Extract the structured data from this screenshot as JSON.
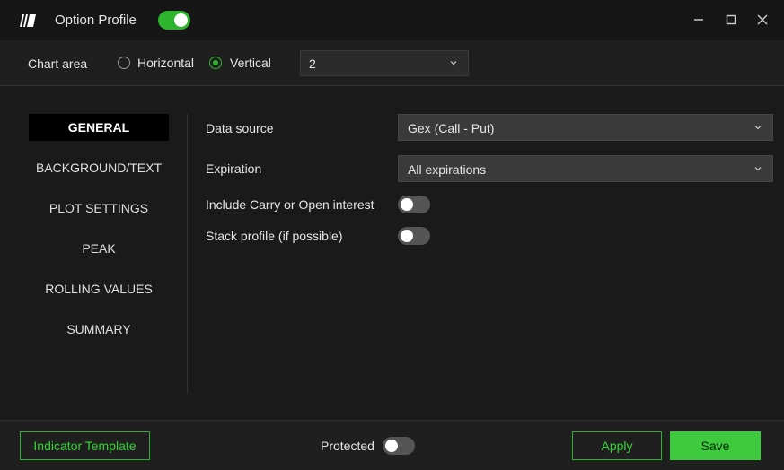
{
  "window": {
    "title": "Option Profile",
    "enabled": true
  },
  "chart_area": {
    "label": "Chart area",
    "options": [
      "Horizontal",
      "Vertical"
    ],
    "selected": "Vertical",
    "count_value": "2"
  },
  "nav": {
    "items": [
      "GENERAL",
      "BACKGROUND/TEXT",
      "PLOT SETTINGS",
      "PEAK",
      "ROLLING VALUES",
      "SUMMARY"
    ],
    "active": "GENERAL"
  },
  "general": {
    "data_source_label": "Data source",
    "data_source_value": "Gex (Call - Put)",
    "expiration_label": "Expiration",
    "expiration_value": "All expirations",
    "include_carry_label": "Include Carry or Open interest",
    "include_carry_on": false,
    "stack_profile_label": "Stack profile (if possible)",
    "stack_profile_on": false
  },
  "footer": {
    "indicator_template": "Indicator Template",
    "protected_label": "Protected",
    "protected_on": false,
    "apply": "Apply",
    "save": "Save"
  },
  "colors": {
    "accent": "#2db52d",
    "background": "#1a1a1a"
  }
}
